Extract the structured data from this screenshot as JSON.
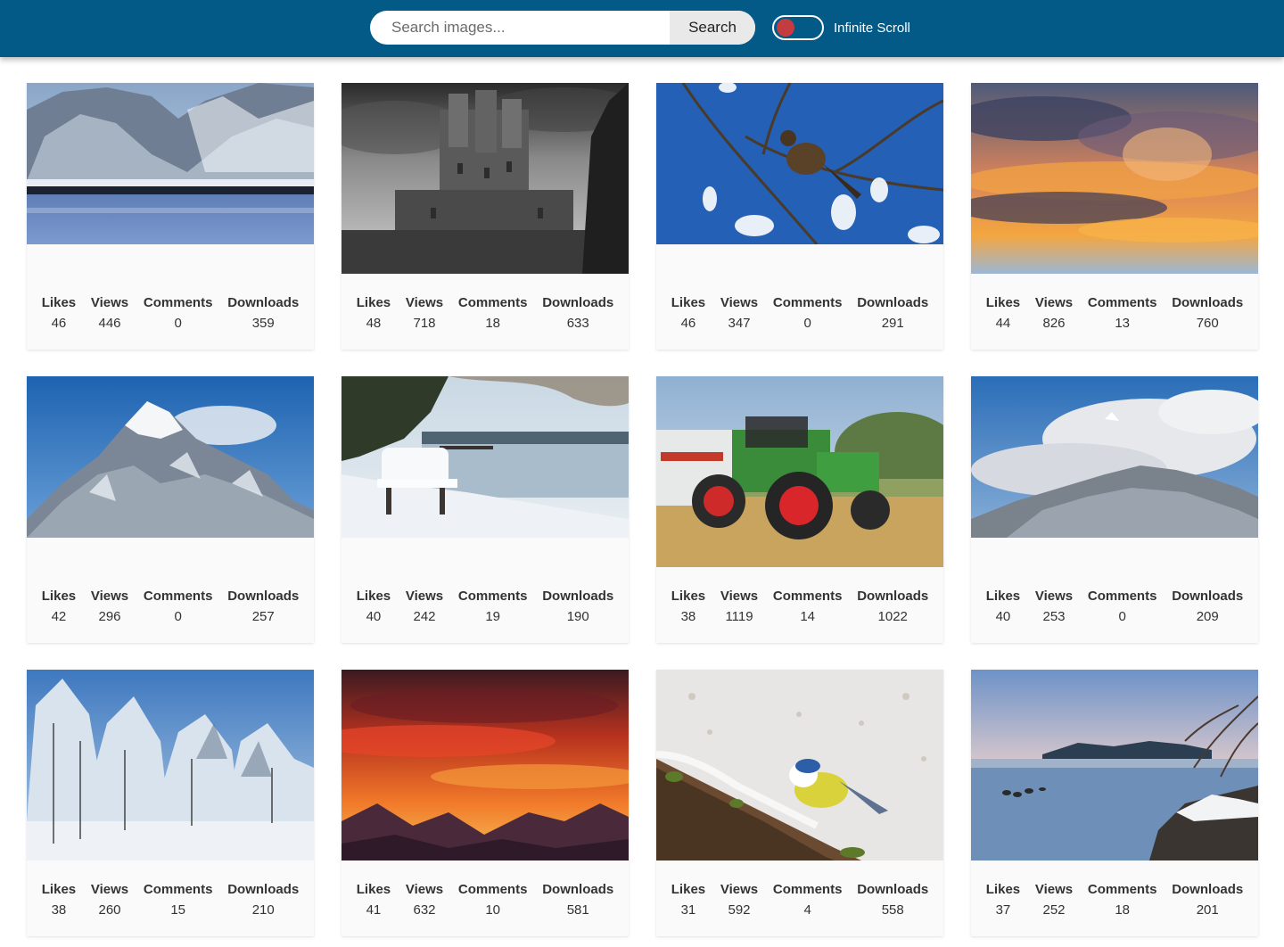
{
  "header": {
    "search_placeholder": "Search images...",
    "search_button": "Search",
    "toggle_label": "Infinite Scroll",
    "toggle_on": false,
    "colors": {
      "bar": "#035a87",
      "toggle_knob": "#c43c3f"
    }
  },
  "stat_labels": {
    "likes": "Likes",
    "views": "Views",
    "comments": "Comments",
    "downloads": "Downloads"
  },
  "cards": [
    {
      "image": "snowy-mountain-lake",
      "likes": "46",
      "views": "446",
      "comments": "0",
      "downloads": "359"
    },
    {
      "image": "black-and-white-castle",
      "likes": "48",
      "views": "718",
      "comments": "18",
      "downloads": "633"
    },
    {
      "image": "bird-on-branch-blue-sky",
      "likes": "46",
      "views": "347",
      "comments": "0",
      "downloads": "291"
    },
    {
      "image": "sunset-clouds",
      "likes": "44",
      "views": "826",
      "comments": "13",
      "downloads": "760"
    },
    {
      "image": "snowy-mountain-peak",
      "likes": "42",
      "views": "296",
      "comments": "0",
      "downloads": "257"
    },
    {
      "image": "snow-covered-bench-lake",
      "likes": "40",
      "views": "242",
      "comments": "19",
      "downloads": "190"
    },
    {
      "image": "green-tractor-field",
      "likes": "38",
      "views": "1119",
      "comments": "14",
      "downloads": "1022"
    },
    {
      "image": "mountain-clouds",
      "likes": "40",
      "views": "253",
      "comments": "0",
      "downloads": "209"
    },
    {
      "image": "snowy-forest",
      "likes": "38",
      "views": "260",
      "comments": "15",
      "downloads": "210"
    },
    {
      "image": "red-sunset-mountains",
      "likes": "41",
      "views": "632",
      "comments": "10",
      "downloads": "581"
    },
    {
      "image": "blue-tit-on-snowy-log",
      "likes": "31",
      "views": "592",
      "comments": "4",
      "downloads": "558"
    },
    {
      "image": "winter-lake-ducks",
      "likes": "37",
      "views": "252",
      "comments": "18",
      "downloads": "201"
    }
  ]
}
